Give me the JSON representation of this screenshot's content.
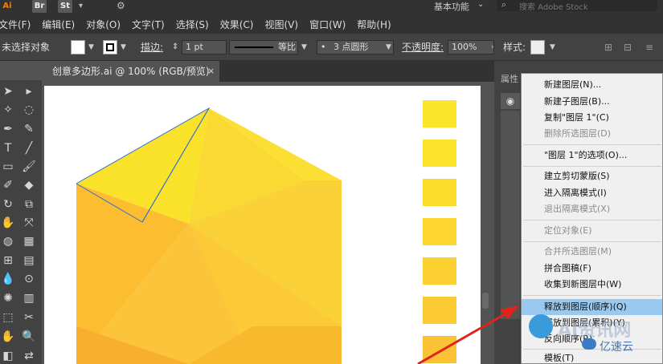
{
  "app": {
    "logo_text": "Ai",
    "bridge_label": "Br",
    "stock_label": "St",
    "workspace_label": "基本功能",
    "search_placeholder": "搜索 Adobe Stock"
  },
  "menubar": {
    "items": [
      "文件(F)",
      "编辑(E)",
      "对象(O)",
      "文字(T)",
      "选择(S)",
      "效果(C)",
      "视图(V)",
      "窗口(W)",
      "帮助(H)"
    ]
  },
  "controlbar": {
    "selection_status": "未选择对象",
    "stroke_label": "描边:",
    "stroke_value": "1 pt",
    "stroke_profile_label": "等比",
    "brush_label": "3 点圆形",
    "opacity_label": "不透明度:",
    "opacity_value": "100%",
    "style_label": "样式:"
  },
  "document": {
    "tab_title": "创意多边形.ai @ 100% (RGB/预览)",
    "close_glyph": "×"
  },
  "panel": {
    "tab_label": "属性"
  },
  "context_menu": {
    "items": [
      {
        "label": "新建图层(N)...",
        "disabled": false
      },
      {
        "label": "新建子图层(B)...",
        "disabled": false
      },
      {
        "label": "复制\"图层 1\"(C)",
        "disabled": false
      },
      {
        "label": "删除所选图层(D)",
        "disabled": true
      },
      {
        "label": "\"图层 1\"的选项(O)...",
        "disabled": false
      },
      {
        "label": "建立剪切蒙版(S)",
        "disabled": false
      },
      {
        "label": "进入隔离模式(I)",
        "disabled": false
      },
      {
        "label": "退出隔离模式(X)",
        "disabled": true
      },
      {
        "label": "定位对象(E)",
        "disabled": true
      },
      {
        "label": "合并所选图层(M)",
        "disabled": true
      },
      {
        "label": "拼合图稿(F)",
        "disabled": false
      },
      {
        "label": "收集到新图层中(W)",
        "disabled": false
      },
      {
        "label": "释放到图层(顺序)(Q)",
        "disabled": false,
        "highlighted": true
      },
      {
        "label": "释放到图层(累积)(Y)",
        "disabled": false
      },
      {
        "label": "反向顺序(R)",
        "disabled": false
      },
      {
        "label": "模板(T)",
        "disabled": false
      }
    ]
  },
  "watermark": {
    "brand": "AI资讯网",
    "sub": "亿速云"
  },
  "colors": {
    "accent_highlight": "#99c9ef",
    "arrow_red": "#e0241b",
    "polygon_yellow": "#fbd533",
    "swatch_yellow": "#fbd82a"
  },
  "icons": [
    "selection-tool-icon",
    "direct-selection-icon",
    "pen-icon",
    "type-icon",
    "rectangle-icon",
    "brush-icon",
    "eraser-icon",
    "rotate-icon",
    "eyedropper-icon",
    "graph-icon",
    "hand-icon",
    "zoom-icon",
    "eye-icon",
    "search-icon"
  ]
}
